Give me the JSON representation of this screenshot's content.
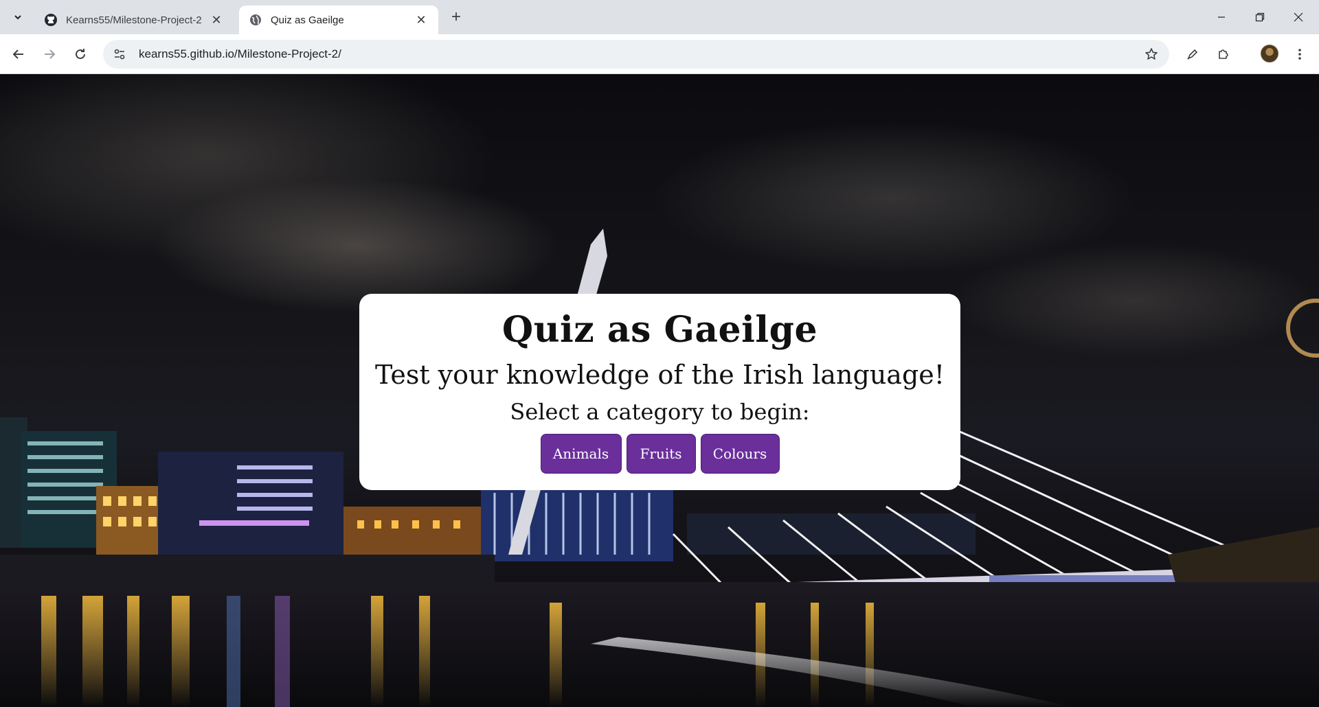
{
  "browser": {
    "tabs": [
      {
        "title": "Kearns55/Milestone-Project-2",
        "icon": "github-icon",
        "active": false
      },
      {
        "title": "Quiz as Gaeilge",
        "icon": "globe-icon",
        "active": true
      }
    ],
    "address_bar": {
      "url": "kearns55.github.io/Milestone-Project-2/"
    }
  },
  "quiz": {
    "title": "Quiz as Gaeilge",
    "subtitle": "Test your knowledge of the Irish language!",
    "prompt": "Select a category to begin:",
    "categories": [
      "Animals",
      "Fruits",
      "Colours"
    ]
  },
  "colors": {
    "button_bg": "#6a2f9b",
    "card_bg": "#ffffff",
    "tabstrip_bg": "#dee1e6"
  }
}
